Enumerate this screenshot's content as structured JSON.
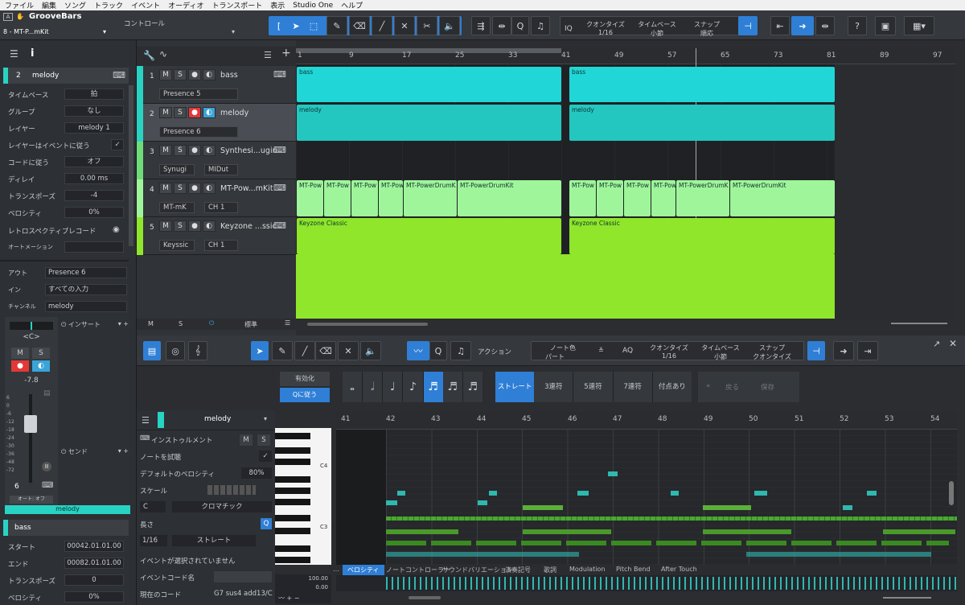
{
  "menu": [
    "ファイル",
    "編集",
    "ソング",
    "トラック",
    "イベント",
    "オーディオ",
    "トランスポート",
    "表示",
    "Studio One",
    "ヘルプ"
  ],
  "header": {
    "song_title": "GrooveBars",
    "track_sel": "8 - MT-P...mKit",
    "control_label": "コントロール"
  },
  "toolbar": {
    "quantize_label": "クオンタイズ",
    "quantize_value": "1/16",
    "timebase_label": "タイムベース",
    "timebase_value": "小節",
    "snap_label": "スナップ",
    "snap_value": "順応",
    "iq_label": "IQ",
    "help": "?"
  },
  "inspector": {
    "track_num": "2",
    "track_name": "melody",
    "rows": [
      {
        "k": "タイムベース",
        "v": "拍"
      },
      {
        "k": "グループ",
        "v": "なし"
      },
      {
        "k": "レイヤー",
        "v": "melody 1"
      },
      {
        "k": "レイヤーはイベントに従う",
        "v": "✓"
      },
      {
        "k": "コードに従う",
        "v": "オフ"
      },
      {
        "k": "ディレイ",
        "v": "0.00 ms"
      },
      {
        "k": "トランスポーズ",
        "v": "-4"
      },
      {
        "k": "ベロシティ",
        "v": "0%"
      },
      {
        "k": "レトロスペクティブレコード",
        "v": ""
      },
      {
        "k": "オートメーション",
        "v": ""
      }
    ],
    "routing": [
      {
        "k": "アウト",
        "v": "Presence 6"
      },
      {
        "k": "イン",
        "v": "すべての入力"
      },
      {
        "k": "チャンネル",
        "v": "melody"
      }
    ],
    "insert_label": "インサート",
    "send_label": "センド",
    "pan": "<C>",
    "fader_value": "-7.8",
    "fader_scale": [
      "6",
      "0",
      "-6",
      "-12",
      "-18",
      "-24",
      "-30",
      "-36",
      "-48",
      "-72"
    ],
    "ch_num": "6",
    "auto_label": "オート: オフ",
    "channel_name": "melody",
    "event_track": "bass",
    "event_rows": [
      {
        "k": "スタート",
        "v": "00042.01.01.00"
      },
      {
        "k": "エンド",
        "v": "00082.01.01.00"
      },
      {
        "k": "トランスポーズ",
        "v": "0"
      },
      {
        "k": "ベロシティ",
        "v": "0%"
      }
    ]
  },
  "tracks": [
    {
      "num": "1",
      "name": "bass",
      "inst": "Presence 5",
      "ch": ""
    },
    {
      "num": "2",
      "name": "melody",
      "inst": "Presence 6",
      "ch": ""
    },
    {
      "num": "3",
      "name": "Synthesi...ugin",
      "inst": "Synugi",
      "ch": "MIDut"
    },
    {
      "num": "4",
      "name": "MT-Pow...mKit",
      "inst": "MT-mK",
      "ch": "CH 1"
    },
    {
      "num": "5",
      "name": "Keyzone ...ssic",
      "inst": "Keyssic",
      "ch": "CH 1"
    }
  ],
  "track_footer": {
    "m": "M",
    "s": "S",
    "std": "標準"
  },
  "ruler": [
    "1",
    "9",
    "17",
    "25",
    "33",
    "41",
    "49",
    "57",
    "65",
    "73",
    "81",
    "89",
    "97"
  ],
  "clips": [
    {
      "name": "bass",
      "color": "#21d6d6"
    },
    {
      "name": "melody",
      "color": "#24c7c0"
    },
    {
      "name": "MT-Pow",
      "color": "#9ff59a"
    },
    {
      "name": "MT-PowerDrumK",
      "color": "#9ff59a"
    },
    {
      "name": "MT-PowerDrumKit",
      "color": "#9ff59a"
    },
    {
      "name": "Keyzone Classic",
      "color": "#8fe62a"
    }
  ],
  "editor": {
    "action_label": "アクション",
    "note_color_label": "ノート色",
    "note_color_value": "パート",
    "aq": "AQ",
    "quantize_label": "クオンタイズ",
    "quantize_value": "1/16",
    "timebase_label": "タイムベース",
    "timebase_value": "小節",
    "snap_label": "スナップ",
    "snap_value": "クオンタイズ",
    "enable": "有効化",
    "qi": "Qに従う",
    "modes": [
      "ストレート",
      "3連符",
      "5連符",
      "7連符",
      "付点あり"
    ],
    "back": "戻る",
    "apply": "保存",
    "part_name": "melody",
    "instrument_label": "インストゥルメント",
    "audition": "ノートを試聴",
    "def_velocity_label": "デフォルトのベロシティ",
    "def_velocity": "80%",
    "scale_label": "スケール",
    "scale_root": "C",
    "scale_type": "クロマチック",
    "length_label": "長さ",
    "length_value": "1/16",
    "length_type": "ストレート",
    "no_event": "イベントが選択されていません",
    "chord_name_label": "イベントコード名",
    "current_chord_label": "現在のコード",
    "current_chord": "G7 sus4 add13/C",
    "val_top": "100.00",
    "val_bot": "0.00",
    "c4": "C4",
    "c3": "C3",
    "ruler": [
      "41",
      "42",
      "43",
      "44",
      "45",
      "46",
      "47",
      "48",
      "49",
      "50",
      "51",
      "52",
      "53",
      "54"
    ],
    "ctrl_tabs": [
      "ベロシティ",
      "ノートコントローラー",
      "サウンドバリエーション",
      "演奏記号",
      "歌詞",
      "Modulation",
      "Pitch Bend",
      "After Touch"
    ]
  }
}
